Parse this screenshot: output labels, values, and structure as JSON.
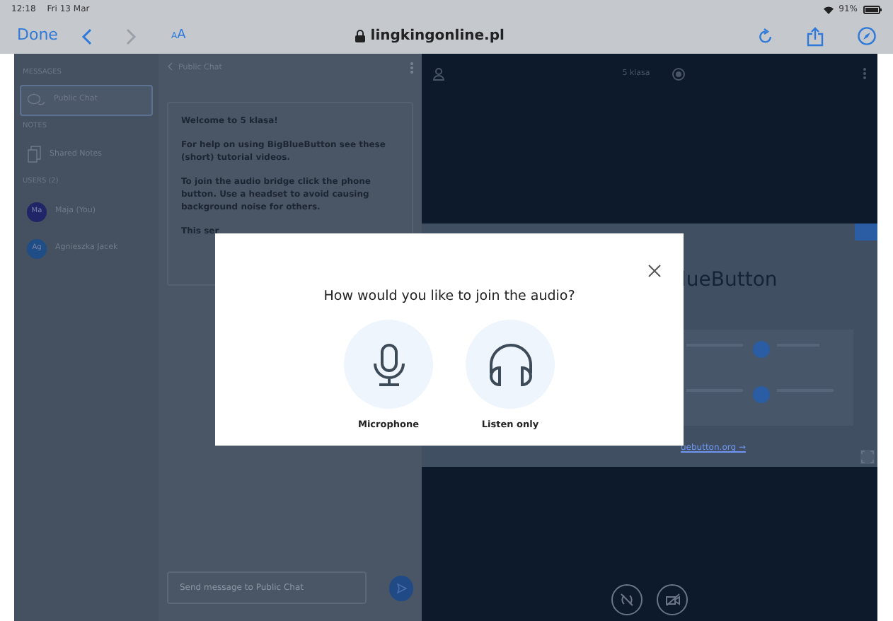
{
  "status_bar": {
    "time": "12:18",
    "date": "Fri 13 Mar",
    "battery": "91%"
  },
  "browser": {
    "done": "Done",
    "text_size": "AA",
    "url": "lingkingonline.pl"
  },
  "sidebar": {
    "sections": [
      {
        "heading": "MESSAGES",
        "items": [
          {
            "kind": "chat",
            "label": "Public Chat",
            "selected": true
          }
        ]
      },
      {
        "heading": "NOTES",
        "items": [
          {
            "kind": "notes",
            "label": "Shared Notes",
            "selected": false
          }
        ]
      },
      {
        "heading": "USERS (2)",
        "items": [
          {
            "kind": "user",
            "initials": "Ma",
            "label": "Maja (You)",
            "color": "#1f2566",
            "selected": false
          },
          {
            "kind": "user",
            "initials": "Ag",
            "label": "Agnieszka Jacek",
            "color": "#1f4d86",
            "selected": false
          }
        ]
      }
    ]
  },
  "chat": {
    "title": "Public Chat",
    "messages": [
      "Welcome to 5 klasa!",
      "For help on using BigBlueButton see these (short) tutorial videos.",
      "To join the audio bridge click the phone button. Use a headset to avoid causing background noise for others.",
      "This ser"
    ],
    "placeholder": "Send message to Public Chat"
  },
  "presentation": {
    "title": "5 klasa",
    "slide": {
      "heading": "lueButton",
      "link": "uebutton.org →"
    }
  },
  "modal": {
    "title": "How would you like to join the audio?",
    "options": [
      {
        "kind": "microphone",
        "label": "Microphone"
      },
      {
        "kind": "listen",
        "label": "Listen only"
      }
    ]
  }
}
